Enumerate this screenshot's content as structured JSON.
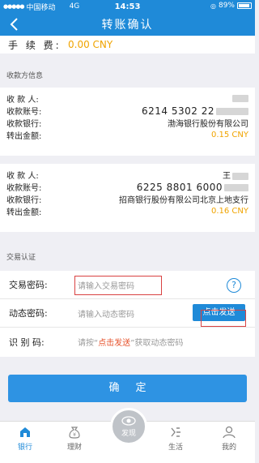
{
  "status_bar": {
    "carrier": "中国移动",
    "network": "4G",
    "time": "14:53",
    "battery": "89%"
  },
  "nav": {
    "title": "转账确认"
  },
  "fee": {
    "label": "手 续 费:",
    "value": "0.00 CNY"
  },
  "payee_section": {
    "header": "收款方信息"
  },
  "payees": [
    {
      "name_label": "收 款 人:",
      "account_label": "收款账号:",
      "account": "6214 5302 22",
      "bank_label": "收款银行:",
      "bank": "渤海银行股份有限公司",
      "amount_label": "转出金额:",
      "amount": "0.15 CNY"
    },
    {
      "name_label": "收 款 人:",
      "name": "王",
      "account_label": "收款账号:",
      "account": "6225 8801 6000",
      "bank_label": "收款银行:",
      "bank": "招商银行股份有限公司北京上地支行",
      "amount_label": "转出金额:",
      "amount": "0.16 CNY"
    }
  ],
  "auth_section": {
    "header": "交易认证"
  },
  "auth": {
    "tx_password_label": "交易密码:",
    "tx_password_placeholder": "请输入交易密码",
    "dyn_password_label": "动态密码:",
    "dyn_password_placeholder": "请输入动态密码",
    "send_button": "点击发送",
    "id_code_label": "识 别 码:",
    "id_hint_pre": "请按“",
    "id_hint_em": "点击发送",
    "id_hint_post": "”获取动态密码"
  },
  "confirm_button": "确定",
  "tabs": [
    {
      "label": "银行",
      "icon": "home-icon"
    },
    {
      "label": "理财",
      "icon": "money-bag-icon"
    },
    {
      "label": "发现",
      "icon": "eye-icon"
    },
    {
      "label": "生活",
      "icon": "life-icon"
    },
    {
      "label": "我的",
      "icon": "user-icon"
    }
  ],
  "colors": {
    "primary": "#1f8ad8",
    "amount": "#f0a400",
    "highlight": "#d94242"
  }
}
